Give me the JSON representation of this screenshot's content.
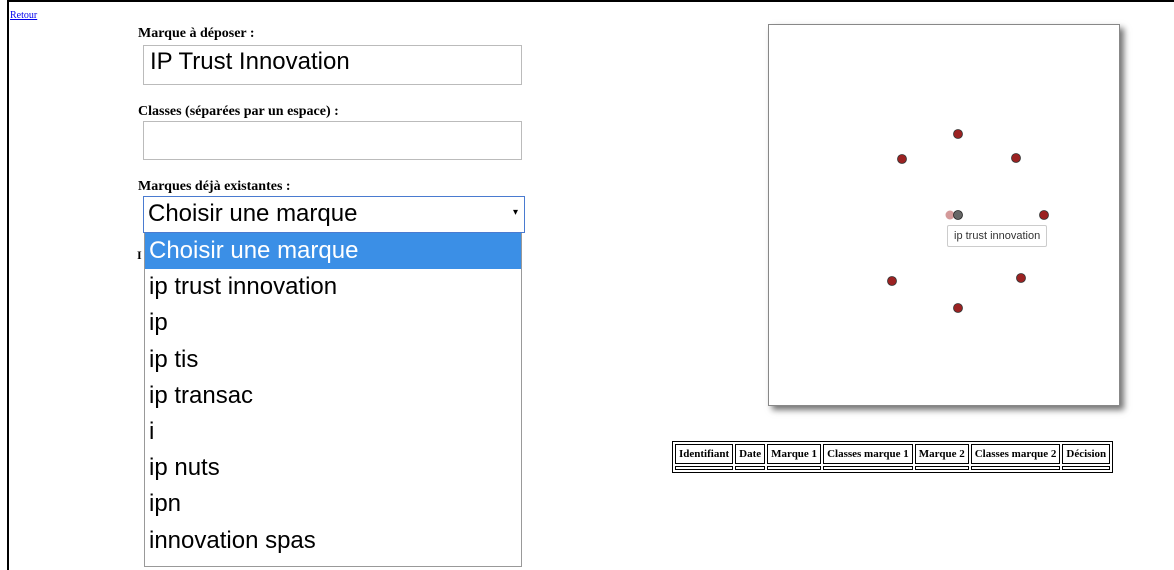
{
  "retour": "Retour",
  "form": {
    "trademark_label": "Marque à déposer :",
    "trademark_value": "IP Trust Innovation",
    "classes_label": "Classes (séparées par un espace) :",
    "classes_value": "",
    "existing_label": "Marques déjà existantes :",
    "select_value": "Choisir une marque",
    "hidden_label_fragment": "I",
    "options": [
      "Choisir une marque",
      "ip trust innovation",
      "ip",
      "ip tis",
      "ip transac",
      "i",
      "ip nuts",
      "ipn",
      "innovation spas"
    ]
  },
  "graph": {
    "tooltip": "ip trust innovation",
    "node_color": "#9b2222",
    "highlight_color": "#666666",
    "faded_color": "#d49a9a"
  },
  "table": {
    "headers": [
      "Identifiant",
      "Date",
      "Marque 1",
      "Classes marque 1",
      "Marque 2",
      "Classes marque 2",
      "Décision"
    ]
  }
}
